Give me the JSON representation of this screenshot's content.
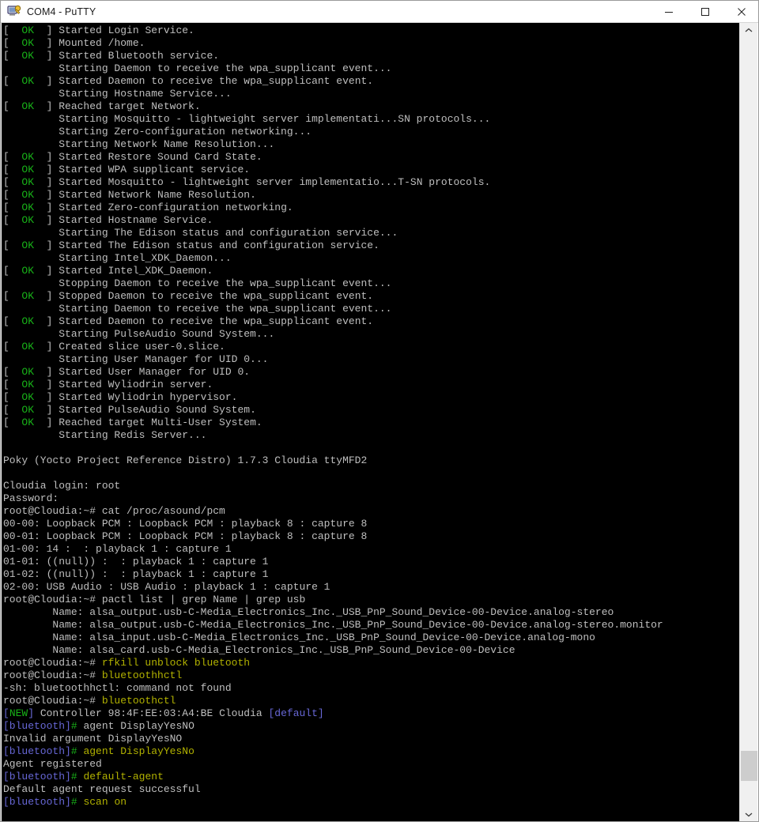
{
  "window": {
    "title": "COM4 - PuTTY",
    "icon": "putty-icon",
    "controls": {
      "minimize_label": "Minimize",
      "maximize_label": "Maximize",
      "close_label": "Close"
    }
  },
  "colors": {
    "background": "#000000",
    "foreground": "#bfbfbf",
    "green": "#18b218",
    "yellow": "#b2b200",
    "blue": "#6767d6",
    "titlebar_bg": "#ffffff",
    "scrollbar_track": "#f0f0f0",
    "scrollbar_thumb": "#cdcdcd"
  },
  "scrollbar": {
    "up_arrow": "chevron-up-icon",
    "down_arrow": "chevron-down-icon",
    "thumb_position_pct": 91
  },
  "terminal": {
    "lines": [
      [
        {
          "t": "[",
          "c": "gray"
        },
        {
          "t": "  OK  ",
          "c": "green"
        },
        {
          "t": "] Started Login Service.",
          "c": "gray"
        }
      ],
      [
        {
          "t": "[",
          "c": "gray"
        },
        {
          "t": "  OK  ",
          "c": "green"
        },
        {
          "t": "] Mounted /home.",
          "c": "gray"
        }
      ],
      [
        {
          "t": "[",
          "c": "gray"
        },
        {
          "t": "  OK  ",
          "c": "green"
        },
        {
          "t": "] Started Bluetooth service.",
          "c": "gray"
        }
      ],
      [
        {
          "t": "         Starting Daemon to receive the wpa_supplicant event...",
          "c": "gray"
        }
      ],
      [
        {
          "t": "[",
          "c": "gray"
        },
        {
          "t": "  OK  ",
          "c": "green"
        },
        {
          "t": "] Started Daemon to receive the wpa_supplicant event.",
          "c": "gray"
        }
      ],
      [
        {
          "t": "         Starting Hostname Service...",
          "c": "gray"
        }
      ],
      [
        {
          "t": "[",
          "c": "gray"
        },
        {
          "t": "  OK  ",
          "c": "green"
        },
        {
          "t": "] Reached target Network.",
          "c": "gray"
        }
      ],
      [
        {
          "t": "         Starting Mosquitto - lightweight server implementati...SN protocols...",
          "c": "gray"
        }
      ],
      [
        {
          "t": "         Starting Zero-configuration networking...",
          "c": "gray"
        }
      ],
      [
        {
          "t": "         Starting Network Name Resolution...",
          "c": "gray"
        }
      ],
      [
        {
          "t": "[",
          "c": "gray"
        },
        {
          "t": "  OK  ",
          "c": "green"
        },
        {
          "t": "] Started Restore Sound Card State.",
          "c": "gray"
        }
      ],
      [
        {
          "t": "[",
          "c": "gray"
        },
        {
          "t": "  OK  ",
          "c": "green"
        },
        {
          "t": "] Started WPA supplicant service.",
          "c": "gray"
        }
      ],
      [
        {
          "t": "[",
          "c": "gray"
        },
        {
          "t": "  OK  ",
          "c": "green"
        },
        {
          "t": "] Started Mosquitto - lightweight server implementatio...T-SN protocols.",
          "c": "gray"
        }
      ],
      [
        {
          "t": "[",
          "c": "gray"
        },
        {
          "t": "  OK  ",
          "c": "green"
        },
        {
          "t": "] Started Network Name Resolution.",
          "c": "gray"
        }
      ],
      [
        {
          "t": "[",
          "c": "gray"
        },
        {
          "t": "  OK  ",
          "c": "green"
        },
        {
          "t": "] Started Zero-configuration networking.",
          "c": "gray"
        }
      ],
      [
        {
          "t": "[",
          "c": "gray"
        },
        {
          "t": "  OK  ",
          "c": "green"
        },
        {
          "t": "] Started Hostname Service.",
          "c": "gray"
        }
      ],
      [
        {
          "t": "         Starting The Edison status and configuration service...",
          "c": "gray"
        }
      ],
      [
        {
          "t": "[",
          "c": "gray"
        },
        {
          "t": "  OK  ",
          "c": "green"
        },
        {
          "t": "] Started The Edison status and configuration service.",
          "c": "gray"
        }
      ],
      [
        {
          "t": "         Starting Intel_XDK_Daemon...",
          "c": "gray"
        }
      ],
      [
        {
          "t": "[",
          "c": "gray"
        },
        {
          "t": "  OK  ",
          "c": "green"
        },
        {
          "t": "] Started Intel_XDK_Daemon.",
          "c": "gray"
        }
      ],
      [
        {
          "t": "         Stopping Daemon to receive the wpa_supplicant event...",
          "c": "gray"
        }
      ],
      [
        {
          "t": "[",
          "c": "gray"
        },
        {
          "t": "  OK  ",
          "c": "green"
        },
        {
          "t": "] Stopped Daemon to receive the wpa_supplicant event.",
          "c": "gray"
        }
      ],
      [
        {
          "t": "         Starting Daemon to receive the wpa_supplicant event...",
          "c": "gray"
        }
      ],
      [
        {
          "t": "[",
          "c": "gray"
        },
        {
          "t": "  OK  ",
          "c": "green"
        },
        {
          "t": "] Started Daemon to receive the wpa_supplicant event.",
          "c": "gray"
        }
      ],
      [
        {
          "t": "         Starting PulseAudio Sound System...",
          "c": "gray"
        }
      ],
      [
        {
          "t": "[",
          "c": "gray"
        },
        {
          "t": "  OK  ",
          "c": "green"
        },
        {
          "t": "] Created slice user-0.slice.",
          "c": "gray"
        }
      ],
      [
        {
          "t": "         Starting User Manager for UID 0...",
          "c": "gray"
        }
      ],
      [
        {
          "t": "[",
          "c": "gray"
        },
        {
          "t": "  OK  ",
          "c": "green"
        },
        {
          "t": "] Started User Manager for UID 0.",
          "c": "gray"
        }
      ],
      [
        {
          "t": "[",
          "c": "gray"
        },
        {
          "t": "  OK  ",
          "c": "green"
        },
        {
          "t": "] Started Wyliodrin server.",
          "c": "gray"
        }
      ],
      [
        {
          "t": "[",
          "c": "gray"
        },
        {
          "t": "  OK  ",
          "c": "green"
        },
        {
          "t": "] Started Wyliodrin hypervisor.",
          "c": "gray"
        }
      ],
      [
        {
          "t": "[",
          "c": "gray"
        },
        {
          "t": "  OK  ",
          "c": "green"
        },
        {
          "t": "] Started PulseAudio Sound System.",
          "c": "gray"
        }
      ],
      [
        {
          "t": "[",
          "c": "gray"
        },
        {
          "t": "  OK  ",
          "c": "green"
        },
        {
          "t": "] Reached target Multi-User System.",
          "c": "gray"
        }
      ],
      [
        {
          "t": "         Starting Redis Server...",
          "c": "gray"
        }
      ],
      [
        {
          "t": "",
          "c": "gray"
        }
      ],
      [
        {
          "t": "Poky (Yocto Project Reference Distro) 1.7.3 Cloudia ttyMFD2",
          "c": "gray"
        }
      ],
      [
        {
          "t": "",
          "c": "gray"
        }
      ],
      [
        {
          "t": "Cloudia login: root",
          "c": "gray"
        }
      ],
      [
        {
          "t": "Password:",
          "c": "gray"
        }
      ],
      [
        {
          "t": "root@Cloudia:~# ",
          "c": "gray"
        },
        {
          "t": "cat /proc/asound/pcm",
          "c": "gray"
        }
      ],
      [
        {
          "t": "00-00: Loopback PCM : Loopback PCM : playback 8 : capture 8",
          "c": "gray"
        }
      ],
      [
        {
          "t": "00-01: Loopback PCM : Loopback PCM : playback 8 : capture 8",
          "c": "gray"
        }
      ],
      [
        {
          "t": "01-00: 14 :  : playback 1 : capture 1",
          "c": "gray"
        }
      ],
      [
        {
          "t": "01-01: ((null)) :  : playback 1 : capture 1",
          "c": "gray"
        }
      ],
      [
        {
          "t": "01-02: ((null)) :  : playback 1 : capture 1",
          "c": "gray"
        }
      ],
      [
        {
          "t": "02-00: USB Audio : USB Audio : playback 1 : capture 1",
          "c": "gray"
        }
      ],
      [
        {
          "t": "root@Cloudia:~# ",
          "c": "gray"
        },
        {
          "t": "pactl list | grep Name | grep usb",
          "c": "gray"
        }
      ],
      [
        {
          "t": "        Name: alsa_output.usb-C-Media_Electronics_Inc._USB_PnP_Sound_Device-00-Device.analog-stereo",
          "c": "gray"
        }
      ],
      [
        {
          "t": "        Name: alsa_output.usb-C-Media_Electronics_Inc._USB_PnP_Sound_Device-00-Device.analog-stereo.monitor",
          "c": "gray"
        }
      ],
      [
        {
          "t": "        Name: alsa_input.usb-C-Media_Electronics_Inc._USB_PnP_Sound_Device-00-Device.analog-mono",
          "c": "gray"
        }
      ],
      [
        {
          "t": "        Name: alsa_card.usb-C-Media_Electronics_Inc._USB_PnP_Sound_Device-00-Device",
          "c": "gray"
        }
      ],
      [
        {
          "t": "root@Cloudia:~# ",
          "c": "gray"
        },
        {
          "t": "rfkill unblock bluetooth",
          "c": "yellow"
        }
      ],
      [
        {
          "t": "root@Cloudia:~# ",
          "c": "gray"
        },
        {
          "t": "bluetoothhctl",
          "c": "yellow"
        }
      ],
      [
        {
          "t": "-sh: bluetoothhctl: command not found",
          "c": "gray"
        }
      ],
      [
        {
          "t": "root@Cloudia:~# ",
          "c": "gray"
        },
        {
          "t": "bluetoothctl",
          "c": "yellow"
        }
      ],
      [
        {
          "t": "[",
          "c": "blue"
        },
        {
          "t": "NEW",
          "c": "green"
        },
        {
          "t": "]",
          "c": "blue"
        },
        {
          "t": " Controller 98:4F:EE:03:A4:BE Cloudia ",
          "c": "gray"
        },
        {
          "t": "[default]",
          "c": "blue"
        }
      ],
      [
        {
          "t": "[bluetooth]",
          "c": "blue"
        },
        {
          "t": "#",
          "c": "green"
        },
        {
          "t": " agent DisplayYesNO",
          "c": "gray"
        }
      ],
      [
        {
          "t": "Invalid argument DisplayYesNO",
          "c": "gray"
        }
      ],
      [
        {
          "t": "[bluetooth]",
          "c": "blue"
        },
        {
          "t": "#",
          "c": "green"
        },
        {
          "t": " ",
          "c": "gray"
        },
        {
          "t": "agent DisplayYesNo",
          "c": "yellow"
        }
      ],
      [
        {
          "t": "Agent registered",
          "c": "gray"
        }
      ],
      [
        {
          "t": "[bluetooth]",
          "c": "blue"
        },
        {
          "t": "#",
          "c": "green"
        },
        {
          "t": " ",
          "c": "gray"
        },
        {
          "t": "default-agent",
          "c": "yellow"
        }
      ],
      [
        {
          "t": "Default agent request successful",
          "c": "gray"
        }
      ],
      [
        {
          "t": "[bluetooth]",
          "c": "blue"
        },
        {
          "t": "#",
          "c": "green"
        },
        {
          "t": " ",
          "c": "gray"
        },
        {
          "t": "scan on",
          "c": "yellow"
        }
      ]
    ]
  }
}
